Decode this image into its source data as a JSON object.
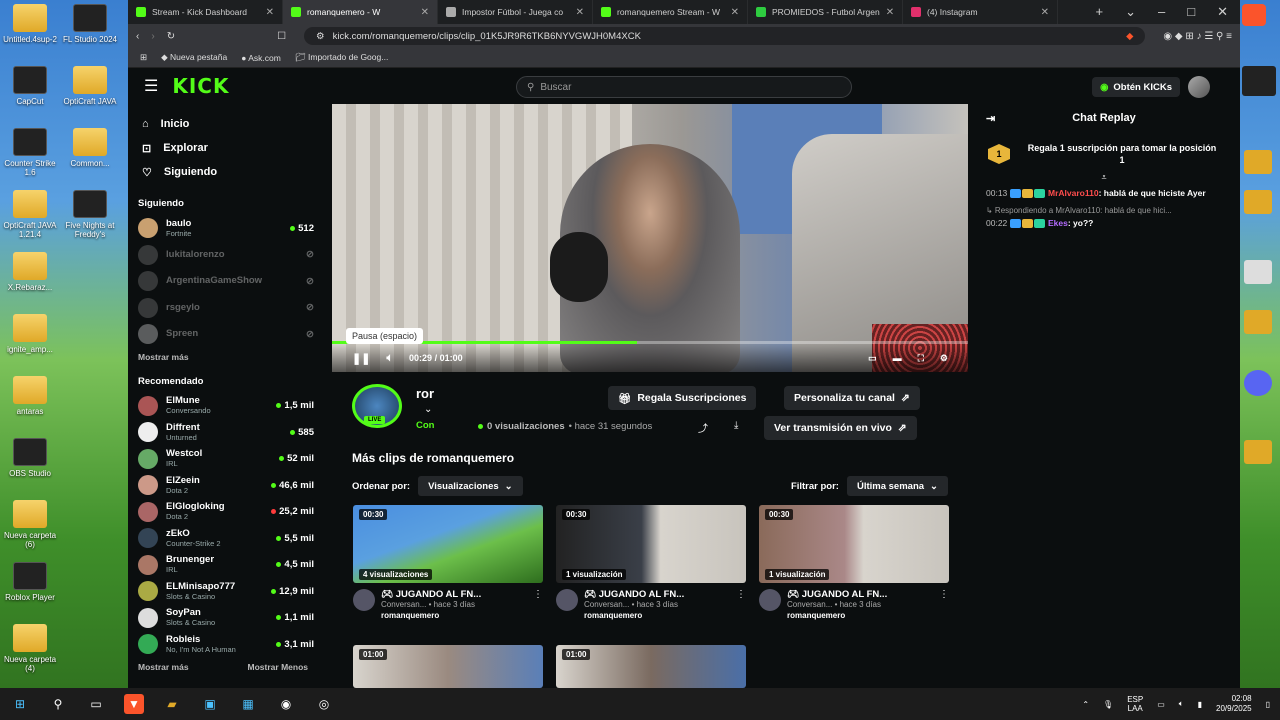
{
  "desktop": {
    "icons": [
      {
        "label": "Untitled.4sup-2",
        "color": "folder"
      },
      {
        "label": "FL Studio 2024",
        "color": "app"
      },
      {
        "label": "CapCut",
        "color": "app"
      },
      {
        "label": "OptiCraft JAVA",
        "color": "folder"
      },
      {
        "label": "Counter Strike 1.6",
        "color": "app"
      },
      {
        "label": "Common...",
        "color": "folder"
      },
      {
        "label": "OptiCraft JAVA 1.21.4",
        "color": "folder"
      },
      {
        "label": "Five Nights at Freddy's",
        "color": "app"
      },
      {
        "label": "X.Rebaraz...",
        "color": "folder"
      },
      {
        "label": "ignite_amp...",
        "color": "folder"
      },
      {
        "label": "antaras",
        "color": "folder"
      },
      {
        "label": "OBS Studio",
        "color": "app"
      },
      {
        "label": "Nueva carpeta (6)",
        "color": "folder"
      },
      {
        "label": "Roblox Player",
        "color": "app"
      },
      {
        "label": "Nueva carpeta (4)",
        "color": "folder"
      }
    ]
  },
  "browser": {
    "tabs": [
      {
        "title": "Stream - Kick Dashboard",
        "active": false,
        "color": "#53fc18"
      },
      {
        "title": "romanquemero - W",
        "active": true,
        "color": "#53fc18"
      },
      {
        "title": "Impostor Fútbol - Juega co",
        "active": false,
        "color": "#aaaaaa"
      },
      {
        "title": "romanquemero Stream - W",
        "active": false,
        "color": "#53fc18"
      },
      {
        "title": "PROMIEDOS - Futbol Argen",
        "active": false,
        "color": "#2ecc40"
      },
      {
        "title": "(4) Instagram",
        "active": false,
        "color": "#e1306c"
      }
    ],
    "url": "kick.com/romanquemero/clips/clip_01K5JR9R6TKB6NYVGWJH0M4XCK",
    "bookmarks": [
      "Nueva pestaña",
      "Ask.com",
      "Importado de Goog..."
    ]
  },
  "kick": {
    "logo": "KICK",
    "search_placeholder": "Buscar",
    "kicks_button": "Obtén KICKs",
    "nav": [
      {
        "label": "Inicio",
        "icon": "home-icon"
      },
      {
        "label": "Explorar",
        "icon": "compass-icon"
      },
      {
        "label": "Siguiendo",
        "icon": "heart-icon"
      }
    ],
    "following_title": "Siguiendo",
    "following": [
      {
        "name": "baulo",
        "game": "Fortnite",
        "viewers": "512",
        "online": true,
        "color": "#c9a070"
      },
      {
        "name": "lukitalorenzo",
        "game": "",
        "viewers": "",
        "online": false,
        "color": "#888"
      },
      {
        "name": "ArgentinaGameShow",
        "game": "",
        "viewers": "",
        "online": false,
        "color": "#888"
      },
      {
        "name": "rsgeylo",
        "game": "",
        "viewers": "",
        "online": false,
        "color": "#888"
      },
      {
        "name": "Spreen",
        "game": "",
        "viewers": "",
        "online": false,
        "color": "#eee"
      }
    ],
    "show_more": "Mostrar más",
    "recommended_title": "Recomendado",
    "recommended": [
      {
        "name": "ElMune",
        "game": "Conversando",
        "viewers": "1,5 mil",
        "dot": "green",
        "color": "#a55"
      },
      {
        "name": "Diffrent",
        "game": "Unturned",
        "viewers": "585",
        "dot": "green",
        "color": "#eee"
      },
      {
        "name": "Westcol",
        "game": "IRL",
        "viewers": "52 mil",
        "dot": "green",
        "color": "#6a6"
      },
      {
        "name": "ElZeein",
        "game": "Dota 2",
        "viewers": "46,6 mil",
        "dot": "green",
        "color": "#c98"
      },
      {
        "name": "ElGlogloking",
        "game": "Dota 2",
        "viewers": "25,2 mil",
        "dot": "red",
        "color": "#a66"
      },
      {
        "name": "zEkO",
        "game": "Counter-Strike 2",
        "viewers": "5,5 mil",
        "dot": "green",
        "color": "#345"
      },
      {
        "name": "Brunenger",
        "game": "IRL",
        "viewers": "4,5 mil",
        "dot": "green",
        "color": "#a76"
      },
      {
        "name": "ELMinisapo777",
        "game": "Slots & Casino",
        "viewers": "12,9 mil",
        "dot": "green",
        "color": "#aa4"
      },
      {
        "name": "SoyPan",
        "game": "Slots & Casino",
        "viewers": "1,1 mil",
        "dot": "green",
        "color": "#ddd"
      },
      {
        "name": "Robleis",
        "game": "No, I'm Not A Human",
        "viewers": "3,1 mil",
        "dot": "green",
        "color": "#3a5"
      }
    ],
    "show_more_bottom": "Mostrar más",
    "show_less": "Mostrar Menos"
  },
  "player": {
    "tooltip": "Pausa (espacio)",
    "time_current": "00:29",
    "time_sep": "/",
    "time_total": "01:00",
    "progress": 0.48
  },
  "stream_info": {
    "channel": "ror",
    "live_badge": "LIVE",
    "con": "Con",
    "views": "0 visualizaciones",
    "ago": "• hace 31 segundos",
    "gift_button": "Regala Suscripciones",
    "customize_button": "Personaliza tu canal",
    "watch_live_button": "Ver transmisión en vivo"
  },
  "clips": {
    "title": "Más clips de romanquemero",
    "sort_label": "Ordenar por:",
    "sort_value": "Visualizaciones",
    "filter_label": "Filtrar por:",
    "filter_value": "Última semana",
    "items": [
      {
        "duration": "00:30",
        "views": "4 visualizaciones",
        "title": "JUGANDO AL FN...",
        "sub": "Conversan... • hace 3 días",
        "author": "romanquemero"
      },
      {
        "duration": "00:30",
        "views": "1 visualización",
        "title": "JUGANDO AL FN...",
        "sub": "Conversan... • hace 3 días",
        "author": "romanquemero"
      },
      {
        "duration": "00:30",
        "views": "1 visualización",
        "title": "JUGANDO AL FN...",
        "sub": "Conversan... • hace 3 días",
        "author": "romanquemero"
      }
    ],
    "row2": [
      {
        "duration": "01:00"
      },
      {
        "duration": "01:00"
      }
    ]
  },
  "chat": {
    "title": "Chat Replay",
    "gift_text": "Regala 1 suscripción para tomar la posición 1",
    "rank": "1",
    "messages": [
      {
        "time": "00:13",
        "user": "MrAlvaro110",
        "user_color": "#ff4d4d",
        "text": ": hablá de que hiciste Ayer",
        "reply": ""
      },
      {
        "time": "00:22",
        "user": "Ekes",
        "user_color": "#b46cff",
        "text": ": yo??",
        "reply": "Respondiendo a MrAlvaro110: hablá de que hici..."
      }
    ]
  },
  "taskbar": {
    "lang": "ESP",
    "lang2": "LAA",
    "time": "02:08",
    "date": "20/9/2025"
  }
}
